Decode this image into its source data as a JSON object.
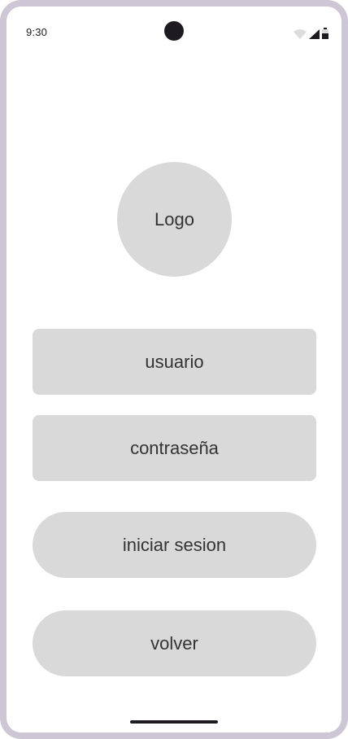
{
  "status_bar": {
    "time": "9:30",
    "icons": [
      "wifi-icon",
      "signal-icon",
      "battery-icon"
    ]
  },
  "logo": {
    "label": "Logo"
  },
  "form": {
    "username_placeholder": "usuario",
    "password_placeholder": "contraseña"
  },
  "actions": {
    "login_label": "iniciar sesion",
    "back_label": "volver"
  },
  "colors": {
    "frame": "#cdc6d4",
    "placeholder_fill": "#d9d9d9",
    "text": "#333333",
    "status_ink": "#1d1b20"
  }
}
